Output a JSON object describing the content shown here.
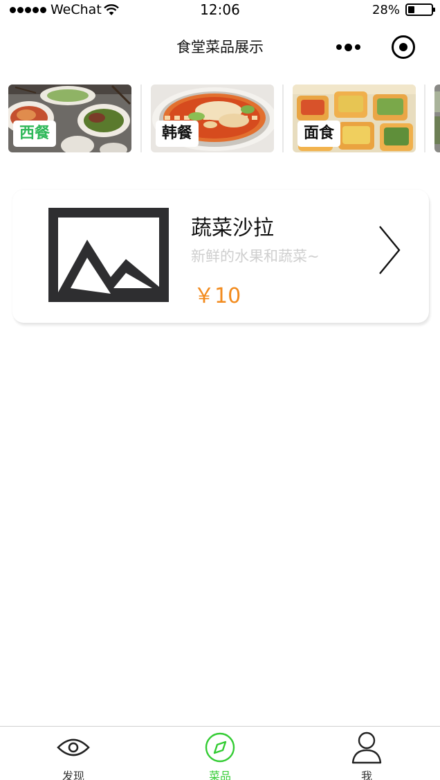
{
  "status_bar": {
    "carrier": "WeChat",
    "time": "12:06",
    "battery_percent": "28%",
    "battery_level": 0.28
  },
  "nav": {
    "title": "食堂菜品展示",
    "more_icon": "more-dots-icon",
    "close_icon": "target-close-icon"
  },
  "categories": [
    {
      "label": "西餐",
      "active": true
    },
    {
      "label": "韩餐",
      "active": false
    },
    {
      "label": "面食",
      "active": false
    }
  ],
  "dish": {
    "name": "蔬菜沙拉",
    "description": "新鲜的水果和蔬菜~",
    "price": "￥10",
    "image_icon": "image-placeholder-icon",
    "arrow_icon": "chevron-right-icon"
  },
  "tab_bar": {
    "items": [
      {
        "label": "发现",
        "icon": "eye-icon",
        "active": false
      },
      {
        "label": "菜品",
        "icon": "compass-icon",
        "active": true
      },
      {
        "label": "我",
        "icon": "person-icon",
        "active": false
      }
    ]
  },
  "colors": {
    "active_category": "#2fb85a",
    "active_tab": "#33cc33",
    "price": "#f28a1c",
    "description": "#cfcfcf"
  }
}
